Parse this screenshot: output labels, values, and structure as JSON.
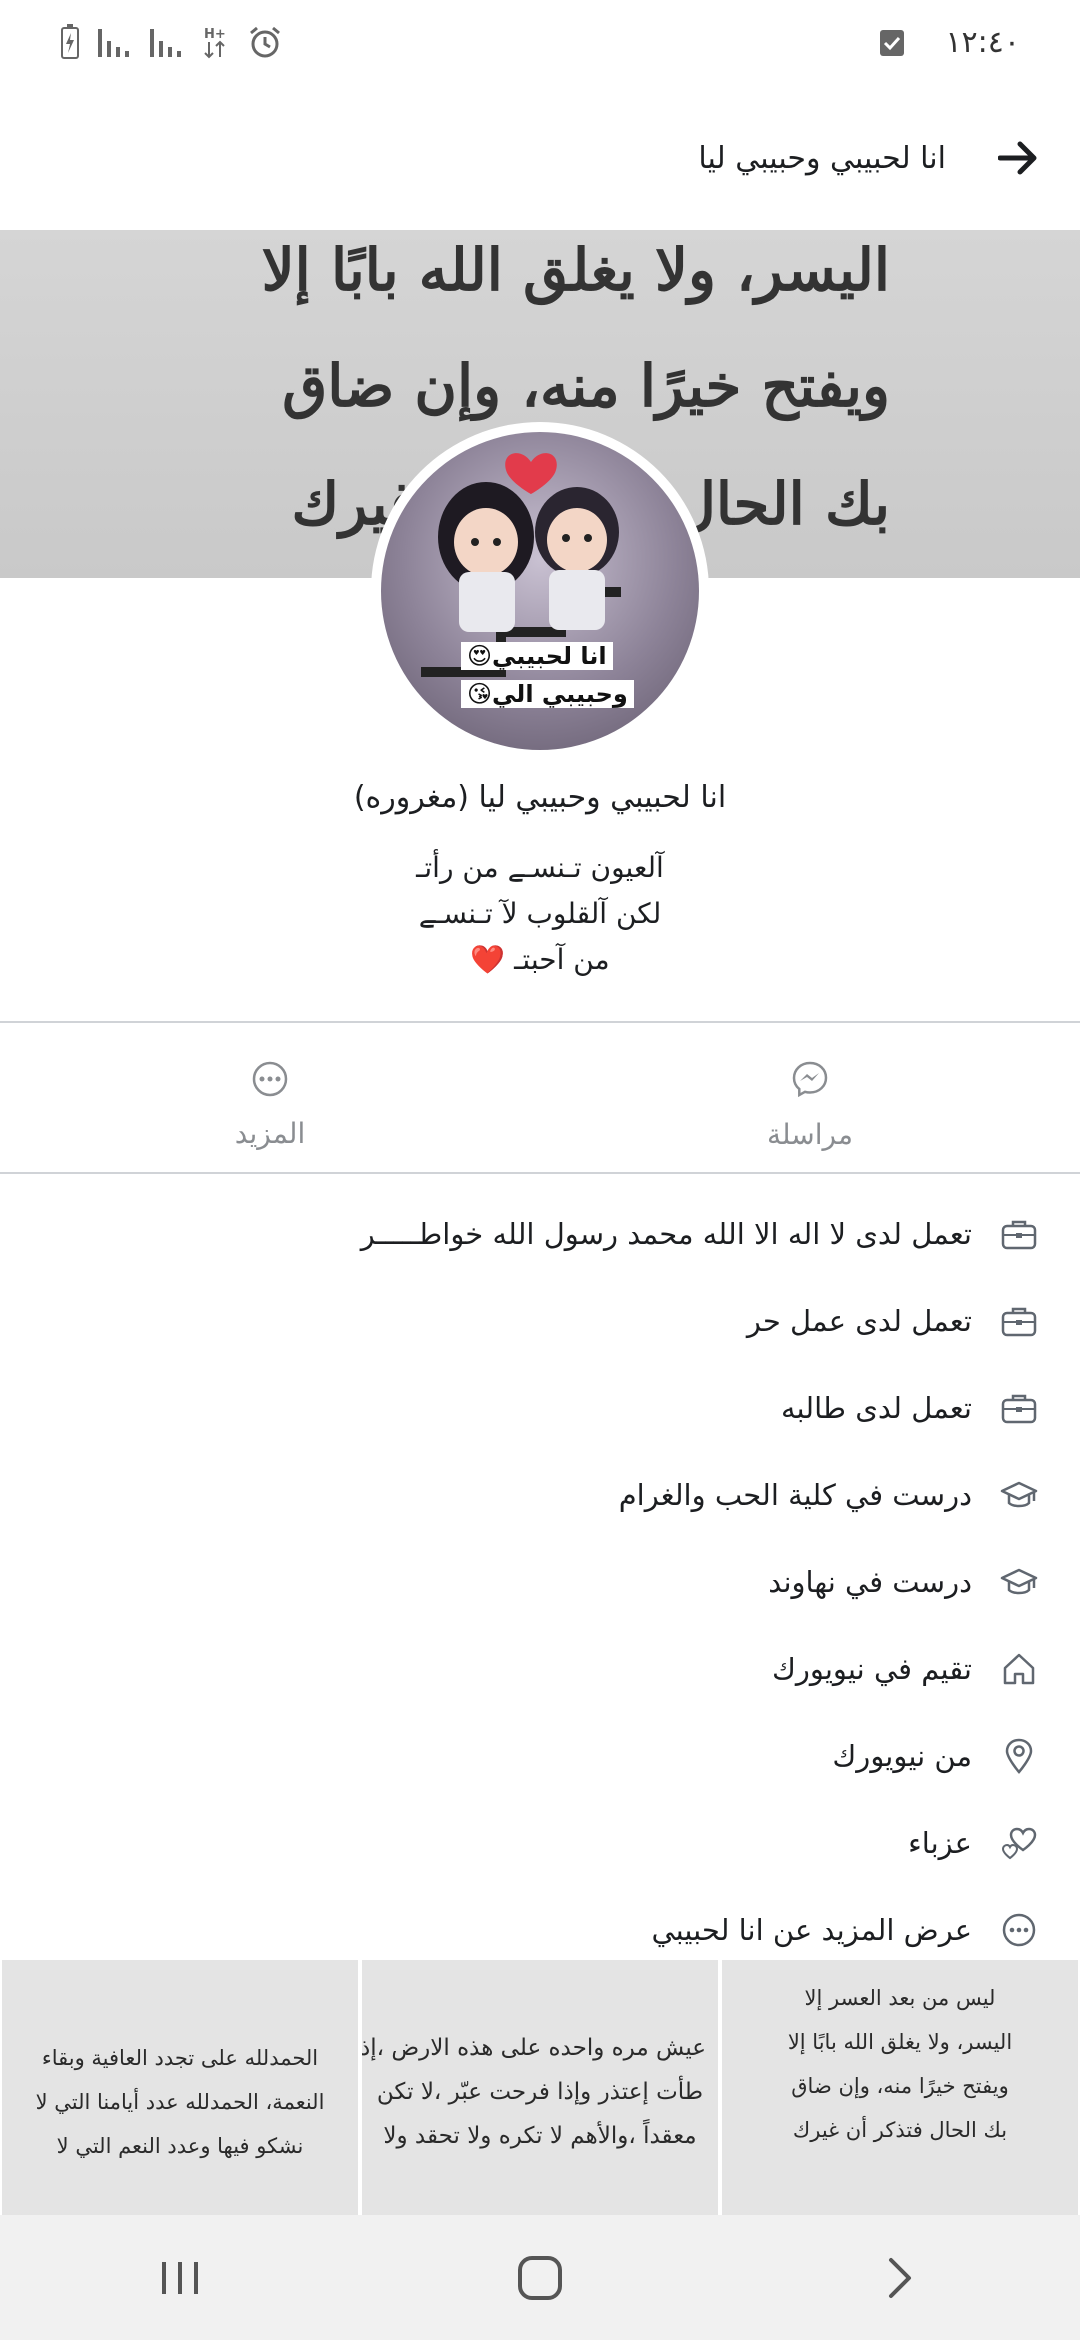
{
  "status_bar": {
    "time": "١٢:٤٠",
    "icons": [
      "checkbox-notification-icon",
      "battery-icon",
      "signal-icon",
      "signal-icon",
      "hplus-data-icon",
      "alarm-icon"
    ]
  },
  "header": {
    "title": "انا لحبيبي وحبيبي ليا",
    "back_icon": "arrow-right-icon"
  },
  "cover": {
    "lines": [
      "اليسر، ولا يغلق الله بابًا إلا",
      "ويفتح خيرًا منه، وإن ضاق",
      "بك الحال فتذكر أن غيرك"
    ]
  },
  "avatar": {
    "caption_line1": "انا لحبيبي😍",
    "caption_line2": "وحبيبي الي😘"
  },
  "profile": {
    "name": "انا لحبيبي وحبيبي ليا (مغروره)",
    "bio": [
      "آلعيون تـنسـے من رأتـ",
      "لكن آلقلوب لآ تـنسـے",
      "من آحبتـ ❤️"
    ]
  },
  "actions": {
    "message_label": "مراسلة",
    "more_label": "المزيد"
  },
  "details": [
    {
      "icon": "briefcase-icon",
      "text": "تعمل لدى لا اله الا الله محمد رسول الله خواطـــــر"
    },
    {
      "icon": "briefcase-icon",
      "text": "تعمل لدى عمل حر"
    },
    {
      "icon": "briefcase-icon",
      "text": "تعمل لدى طالبه"
    },
    {
      "icon": "graduation-cap-icon",
      "text": "درست في كلية الحب والغرام"
    },
    {
      "icon": "graduation-cap-icon",
      "text": "درست في نهاوند"
    },
    {
      "icon": "home-icon",
      "text": "تقيم في نيويورك"
    },
    {
      "icon": "location-pin-icon",
      "text": "من نيويورك"
    },
    {
      "icon": "hearts-icon",
      "text": "عزباء"
    },
    {
      "icon": "more-dots-icon",
      "text": "عرض المزيد عن انا لحبيبي"
    }
  ],
  "photos": [
    {
      "lines": [
        "ليس من بعد العسر إلا",
        "اليسر، ولا يغلق الله بابًا إلا",
        "ويفتح خيرًا منه، وإن ضاق",
        "بك الحال فتذكر أن غيرك"
      ]
    },
    {
      "lines": [
        "عيش مره واحده على هذه الارض ،إذ",
        "طأت إعتذر وإذا فرحت عبّر ،لا تكن",
        "معقداً ،والأهم لا تكره ولا تحقد ولا"
      ]
    },
    {
      "lines": [
        "الحمدلله على تجدد العافية وبقاء",
        "النعمة، الحمدلله عدد أيامنا التي لا",
        "نشكو فيها وعدد النعم التي لا"
      ]
    }
  ],
  "nav": {
    "icons": [
      "recent-apps-icon",
      "home-circle-icon",
      "back-chevron-icon"
    ]
  }
}
